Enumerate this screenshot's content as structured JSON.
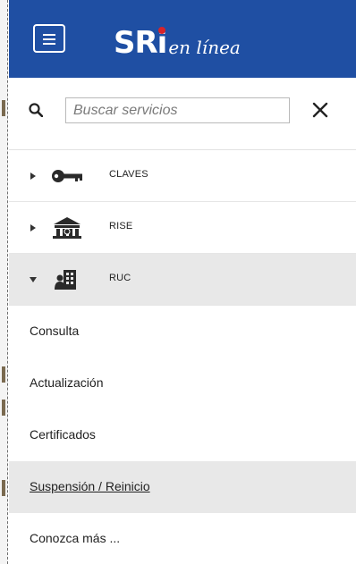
{
  "header": {
    "logo_main": "SRi",
    "logo_script": "en línea",
    "brand_color": "#1f4fa3",
    "logo_dot_color": "#d8232a",
    "menu_icon": "hamburger-icon"
  },
  "search": {
    "placeholder": "Buscar servicios",
    "value": "",
    "search_icon": "magnifier-icon",
    "close_icon": "close-icon"
  },
  "menu": {
    "items": [
      {
        "label": "CLAVES",
        "icon": "key-icon",
        "expanded": false
      },
      {
        "label": "RISE",
        "icon": "bank-icon",
        "expanded": false
      },
      {
        "label": "RUC",
        "icon": "building-icon",
        "expanded": true
      }
    ],
    "ruc_sub_items": [
      {
        "label": "Consulta"
      },
      {
        "label": "Actualización"
      },
      {
        "label": "Certificados"
      },
      {
        "label": "Suspensión / Reinicio"
      },
      {
        "label": "Conozca más ..."
      }
    ],
    "hover_item": "Suspensión / Reinicio"
  }
}
